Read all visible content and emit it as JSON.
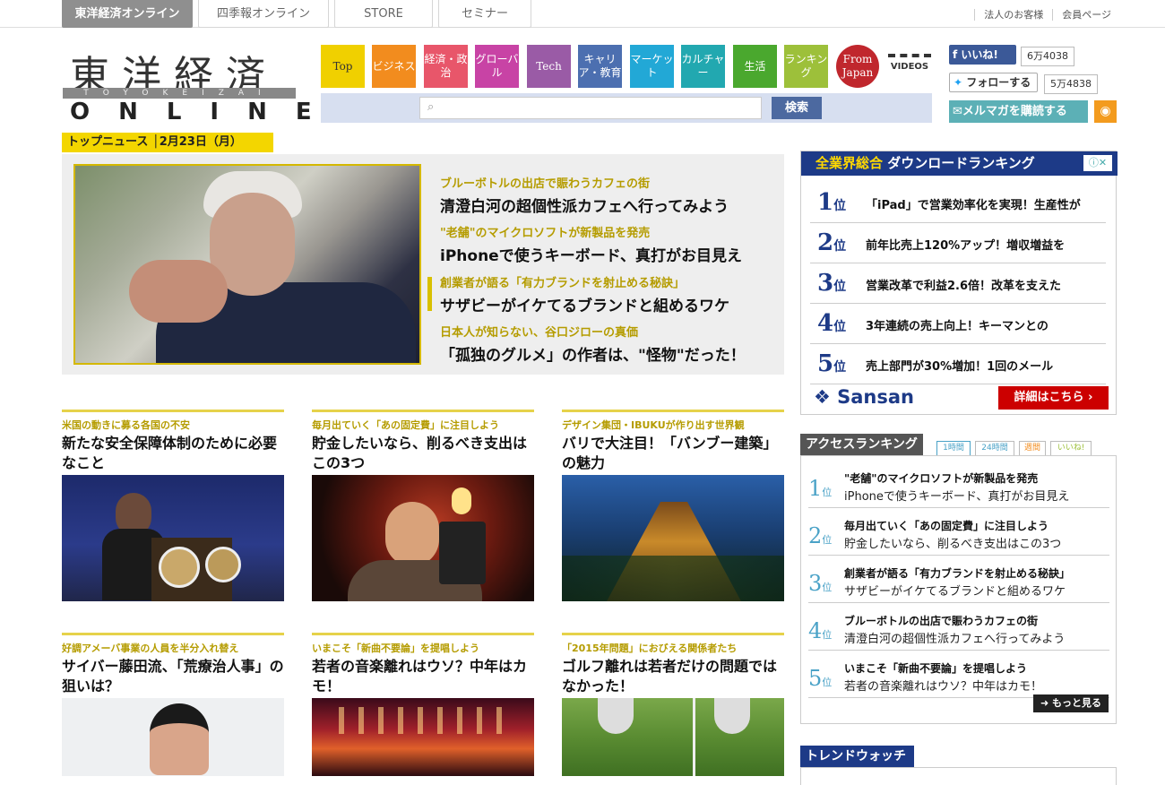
{
  "header": {
    "site_tabs": [
      "東洋経済オンライン",
      "四季報オンライン",
      "STORE",
      "セミナー"
    ],
    "top_links": [
      "法人のお客様",
      "会員ページ"
    ]
  },
  "logo": {
    "kanji": "東洋経済",
    "romaji": "TOYOKEIZAI",
    "online": "ONLINE"
  },
  "nav": {
    "items": [
      {
        "label": "Top",
        "color": "#f0d000"
      },
      {
        "label": "ビジネス",
        "color": "#f28c1e"
      },
      {
        "label": "経済・政治",
        "color": "#e8566a"
      },
      {
        "label": "グローバル",
        "color": "#c843a5"
      },
      {
        "label": "Tech",
        "color": "#9a5ba6"
      },
      {
        "label": "キャリア・教育",
        "color": "#4c6fb0"
      },
      {
        "label": "マーケット",
        "color": "#22a8d6"
      },
      {
        "label": "カルチャー",
        "color": "#22a8b0"
      },
      {
        "label": "生活",
        "color": "#4aa82e"
      },
      {
        "label": "ランキング",
        "color": "#9dc03a"
      },
      {
        "label": "From Japan",
        "color": "#c0272d"
      }
    ],
    "videos_label": "VIDEOS",
    "search_button": "検索"
  },
  "social": {
    "facebook_label": "いいね!",
    "facebook_count": "6万4038",
    "twitter_label": "フォローする",
    "twitter_count": "5万4838",
    "mail_label": "メルマガを購読する"
  },
  "top_news": {
    "label": "トップニュース",
    "date": "2月23日（月）",
    "items": [
      {
        "sub": "ブルーボトルの出店で賑わうカフェの街",
        "main": "清澄白河の超個性派カフェへ行ってみよう"
      },
      {
        "sub": "\"老舗\"のマイクロソフトが新製品を発売",
        "main": "iPhoneで使うキーボード、真打がお目見え"
      },
      {
        "sub": "創業者が語る「有力ブランドを射止める秘訣」",
        "main": "サザビーがイケてるブランドと組めるワケ"
      },
      {
        "sub": "日本人が知らない、谷口ジローの真価",
        "main": "「孤独のグルメ」の作者は、\"怪物\"だった！"
      }
    ]
  },
  "articles": [
    {
      "sub": "米国の動きに募る各国の不安",
      "title": "新たな安全保障体制のために必要なこと"
    },
    {
      "sub": "毎月出ていく「あの固定費」に注目しよう",
      "title": "貯金したいなら、削るべき支出はこの3つ"
    },
    {
      "sub": "デザイン集団・IBUKUが作り出す世界観",
      "title": "バリで大注目！「バンブー建築」の魅力"
    },
    {
      "sub": "好調アメーバ事業の人員を半分入れ替え",
      "title": "サイバー藤田流、「荒療治人事」の狙いは？"
    },
    {
      "sub": "いまこそ「新曲不要論」を提唱しよう",
      "title": "若者の音楽離れはウソ？中年はカモ！"
    },
    {
      "sub": "「2015年問題」におびえる関係者たち",
      "title": "ゴルフ離れは若者だけの問題ではなかった！"
    }
  ],
  "download_ranking": {
    "title_highlight": "全業界総合",
    "title_rest": "ダウンロードランキング",
    "rank_suffix": "位",
    "items": [
      "「iPad」で営業効率化を実現！生産性が",
      "前年比売上120%アップ！増収増益を",
      "営業改革で利益2.6倍！改革を支えた",
      "3年連続の売上向上！キーマンとの",
      "売上部門が30%増加！1回のメール"
    ],
    "sponsor": "Sansan",
    "detail_button": "詳細はこちら"
  },
  "access_ranking": {
    "title": "アクセスランキング",
    "tabs": [
      "1時間",
      "24時間",
      "週間",
      "いいね!"
    ],
    "rank_suffix": "位",
    "items": [
      {
        "sub": "\"老舗\"のマイクロソフトが新製品を発売",
        "main": "iPhoneで使うキーボード、真打がお目見え"
      },
      {
        "sub": "毎月出ていく「あの固定費」に注目しよう",
        "main": "貯金したいなら、削るべき支出はこの3つ"
      },
      {
        "sub": "創業者が語る「有力ブランドを射止める秘訣」",
        "main": "サザビーがイケてるブランドと組めるワケ"
      },
      {
        "sub": "ブルーボトルの出店で賑わうカフェの街",
        "main": "清澄白河の超個性派カフェへ行ってみよう"
      },
      {
        "sub": "いまこそ「新曲不要論」を提唱しよう",
        "main": "若者の音楽離れはウソ？中年はカモ！"
      }
    ],
    "more_button": "もっと見る"
  },
  "trend_watch": {
    "title": "トレンドウォッチ"
  }
}
